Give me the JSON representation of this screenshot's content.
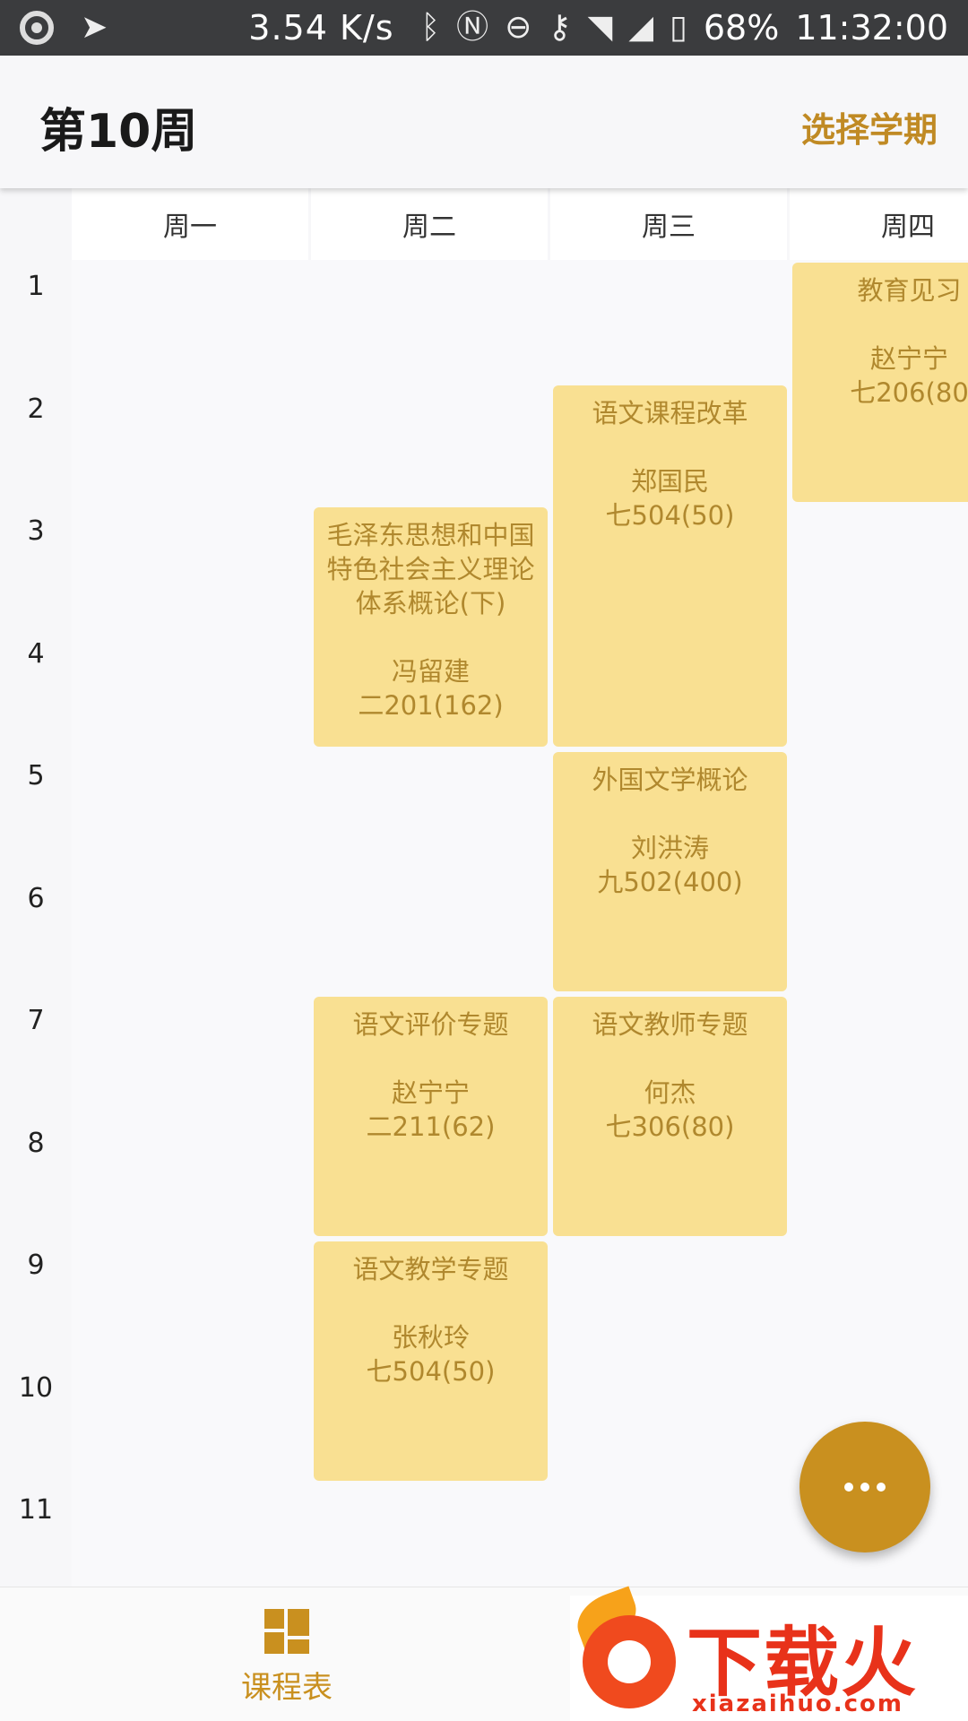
{
  "status_bar": {
    "speed": "3.54 K/s",
    "battery": "68%",
    "time": "11:32:00",
    "icons": [
      "record-icon",
      "send-icon",
      "bluetooth-icon",
      "nfc-icon",
      "dnd-icon",
      "vpn-key-icon",
      "wifi-icon",
      "signal-icon",
      "no-sim-icon"
    ]
  },
  "app_bar": {
    "title": "第10周",
    "action": "选择学期"
  },
  "days": [
    "周一",
    "周二",
    "周三",
    "周四"
  ],
  "slots": [
    "1",
    "2",
    "3",
    "4",
    "5",
    "6",
    "7",
    "8",
    "9",
    "10",
    "11"
  ],
  "courses": [
    {
      "name": "毛泽东思想和中国特色社会主义理论体系概论(下)",
      "teacher": "冯留建",
      "room": "二201(162)",
      "day": "周二",
      "start": 3,
      "end": 4
    },
    {
      "name": "语文评价专题",
      "teacher": "赵宁宁",
      "room": "二211(62)",
      "day": "周二",
      "start": 7,
      "end": 8
    },
    {
      "name": "语文教学专题",
      "teacher": "张秋玲",
      "room": "七504(50)",
      "day": "周二",
      "start": 9,
      "end": 10
    },
    {
      "name": "语文课程改革",
      "teacher": "郑国民",
      "room": "七504(50)",
      "day": "周三",
      "start": 2,
      "end": 4
    },
    {
      "name": "外国文学概论",
      "teacher": "刘洪涛",
      "room": "九502(400)",
      "day": "周三",
      "start": 5,
      "end": 6
    },
    {
      "name": "语文教师专题",
      "teacher": "何杰",
      "room": "七306(80)",
      "day": "周三",
      "start": 7,
      "end": 8
    },
    {
      "name": "教育见习",
      "teacher": "赵宁宁",
      "room": "七206(80",
      "day": "周四",
      "start": 1,
      "end": 2
    }
  ],
  "bottom_nav": {
    "schedule_label": "课程表"
  },
  "watermark": {
    "text": "下载火",
    "url": "xiazaihuo.com"
  },
  "colors": {
    "accent": "#c9901f",
    "course_bg": "#f9e092",
    "course_text": "#b0882e"
  }
}
